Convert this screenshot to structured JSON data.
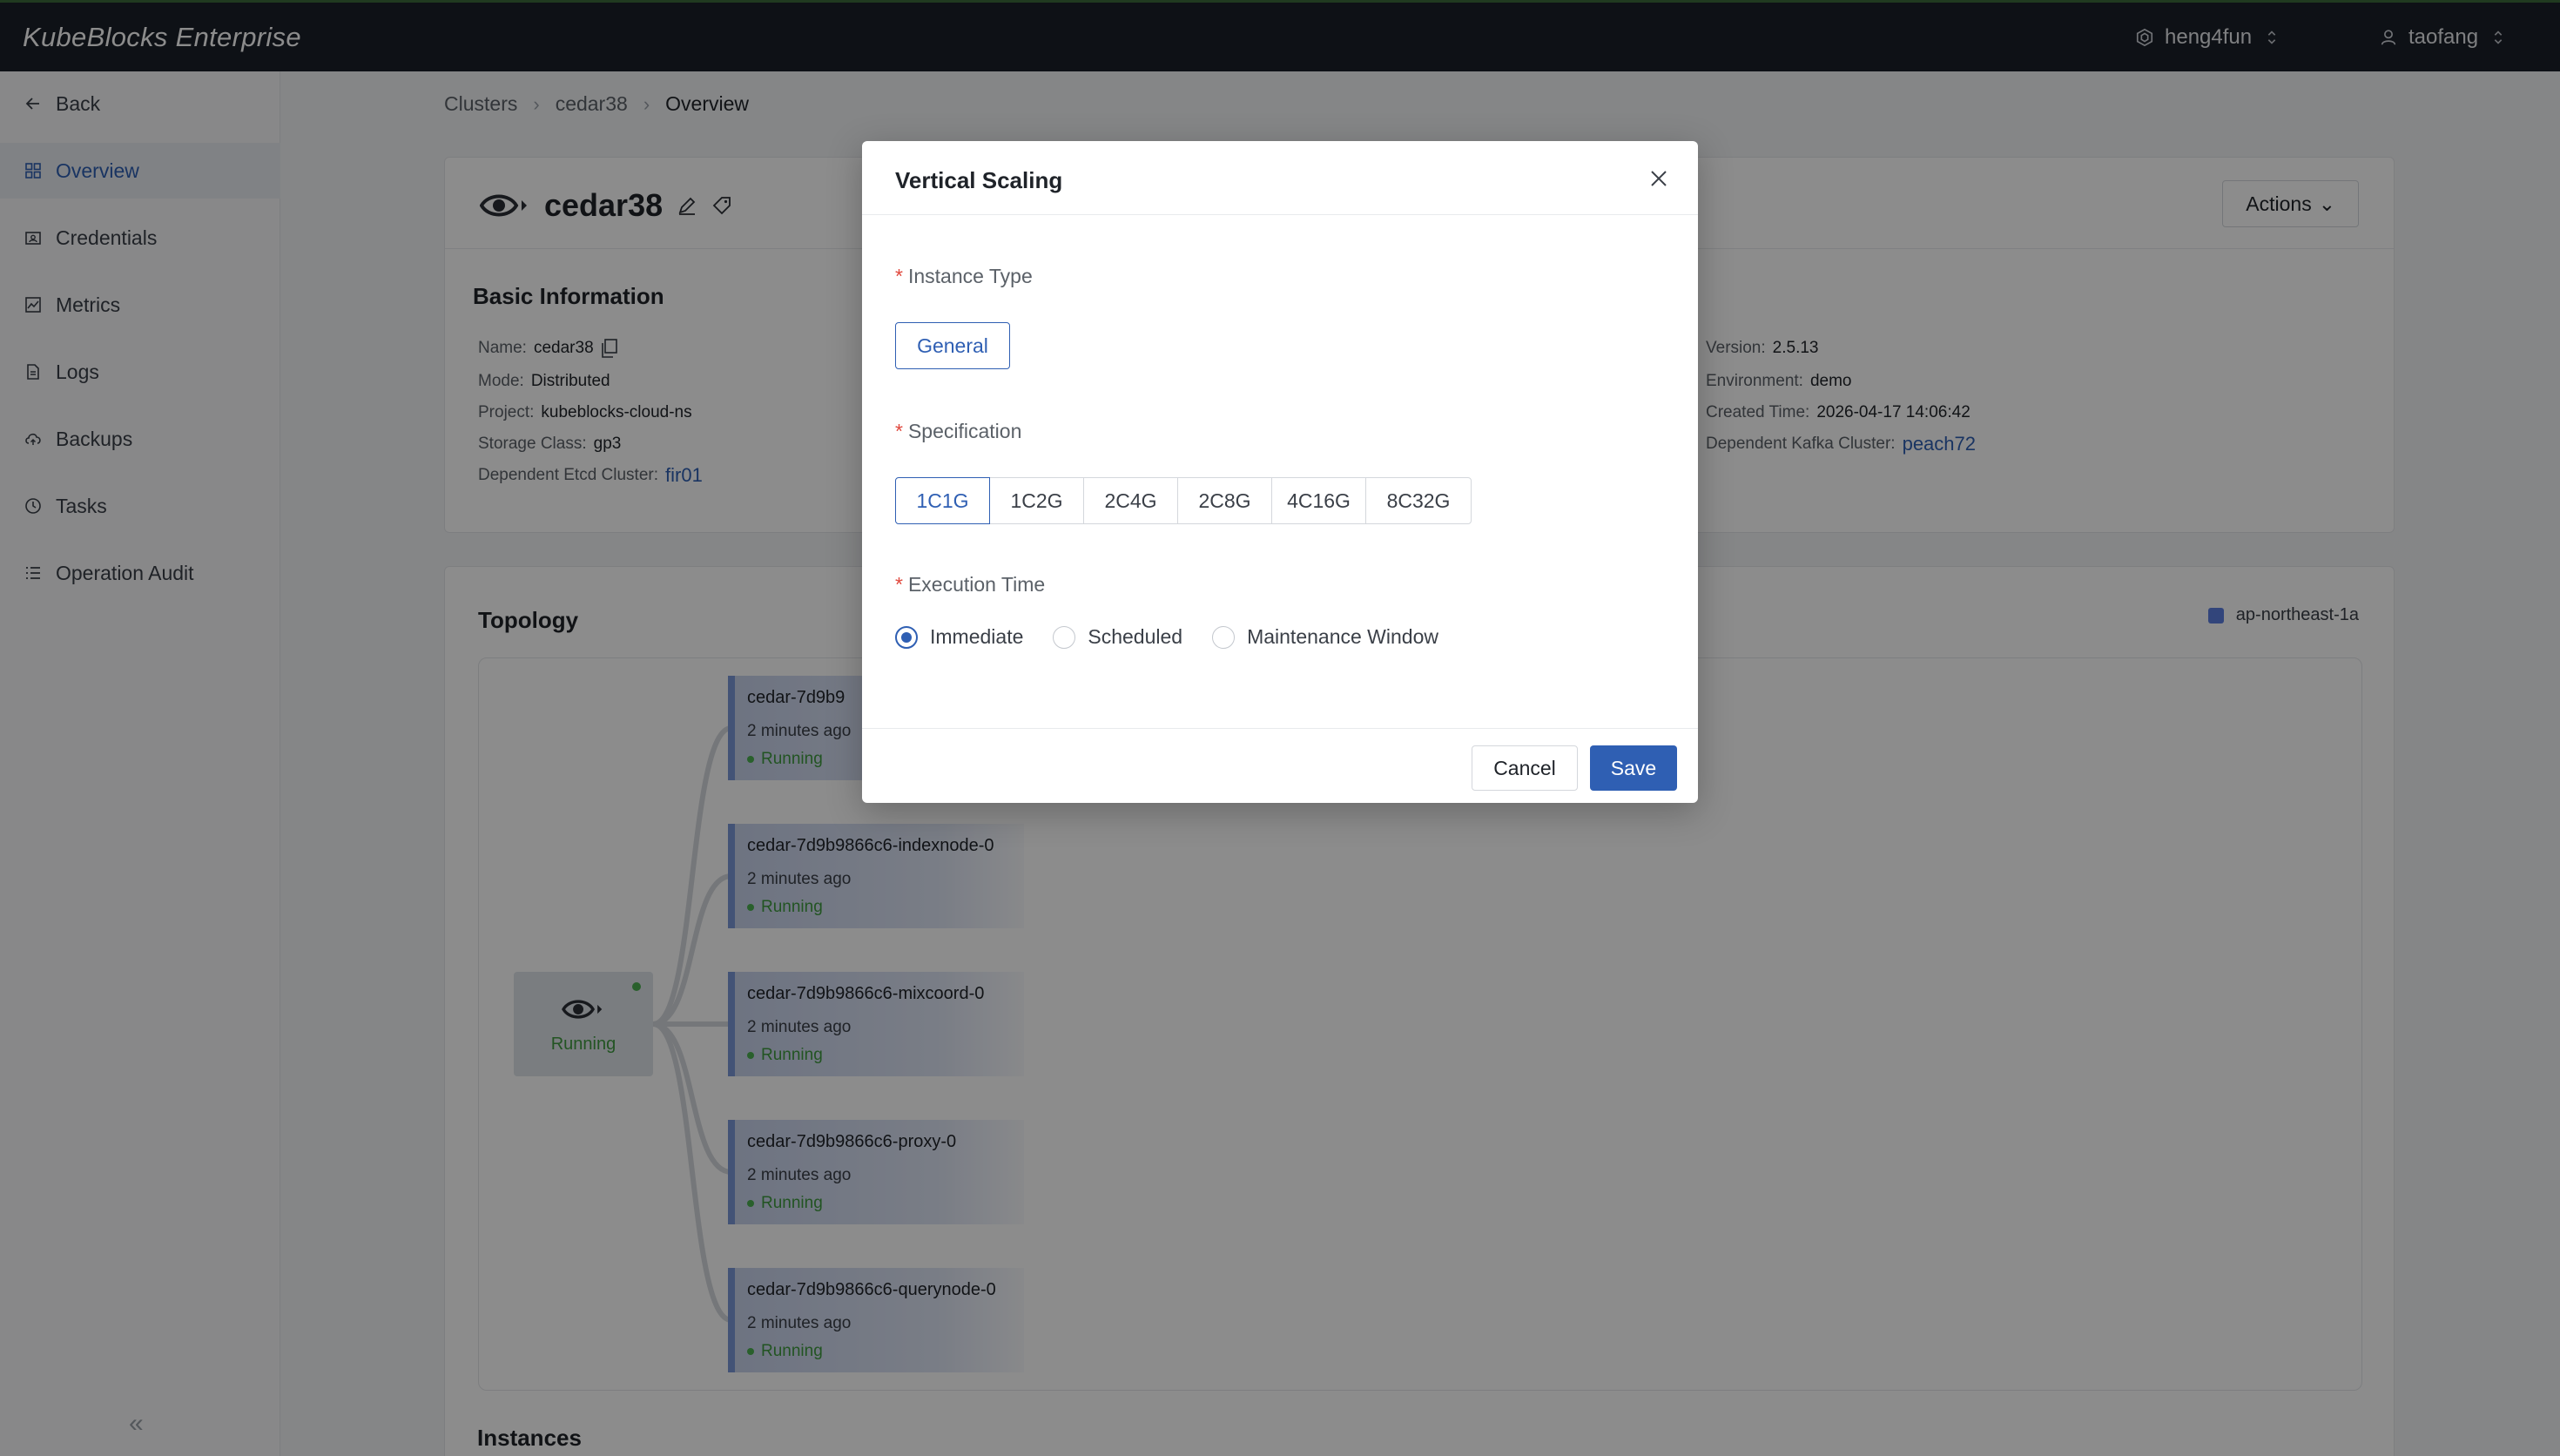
{
  "app": {
    "brand": "KubeBlocks Enterprise"
  },
  "topbar": {
    "org": "heng4fun",
    "user": "taofang"
  },
  "sidebar": {
    "items": [
      {
        "label": "Back",
        "icon": "arrow-left-icon"
      },
      {
        "label": "Overview",
        "icon": "grid-icon",
        "active": true
      },
      {
        "label": "Credentials",
        "icon": "credential-icon"
      },
      {
        "label": "Metrics",
        "icon": "chart-icon"
      },
      {
        "label": "Logs",
        "icon": "file-icon"
      },
      {
        "label": "Backups",
        "icon": "cloud-icon"
      },
      {
        "label": "Tasks",
        "icon": "clock-icon"
      },
      {
        "label": "Operation Audit",
        "icon": "list-icon"
      }
    ],
    "collapse": "«"
  },
  "breadcrumb": [
    "Clusters",
    "cedar38",
    "Overview"
  ],
  "cluster": {
    "name": "cedar38",
    "actions_label": "Actions",
    "basic_title": "Basic Information",
    "left_fields": [
      {
        "k": "Name:",
        "v": "cedar38"
      },
      {
        "k": "Mode:",
        "v": "Distributed"
      },
      {
        "k": "Project:",
        "v": "kubeblocks-cloud-ns"
      },
      {
        "k": "Storage Class:",
        "v": "gp3"
      },
      {
        "k": "Dependent Etcd Cluster:",
        "v": "fir01"
      }
    ],
    "right_fields": [
      {
        "k": "Version:",
        "v": "2.5.13"
      },
      {
        "k": "Environment:",
        "v": "demo"
      },
      {
        "k": "Created Time:",
        "v": "2026-04-17 14:06:42"
      },
      {
        "k": "Dependent Kafka Cluster:",
        "v": "peach72"
      }
    ]
  },
  "topology": {
    "title": "Topology",
    "zone": "ap-northeast-1a",
    "root_status": "Running",
    "nodes": [
      {
        "name": "cedar-7d9b9",
        "time": "2 minutes ago",
        "status": "Running"
      },
      {
        "name": "cedar-7d9b9866c6-indexnode-0",
        "time": "2 minutes ago",
        "status": "Running"
      },
      {
        "name": "cedar-7d9b9866c6-mixcoord-0",
        "time": "2 minutes ago",
        "status": "Running"
      },
      {
        "name": "cedar-7d9b9866c6-proxy-0",
        "time": "2 minutes ago",
        "status": "Running"
      },
      {
        "name": "cedar-7d9b9866c6-querynode-0",
        "time": "2 minutes ago",
        "status": "Running"
      }
    ]
  },
  "instances_title": "Instances",
  "modal": {
    "title": "Vertical Scaling",
    "instance_type_label": "Instance Type",
    "instance_type_value": "General",
    "spec_label": "Specification",
    "specs": [
      "1C1G",
      "1C2G",
      "2C4G",
      "2C8G",
      "4C16G",
      "8C32G"
    ],
    "spec_selected": "1C1G",
    "exec_label": "Execution Time",
    "exec_options": [
      "Immediate",
      "Scheduled",
      "Maintenance Window"
    ],
    "exec_selected": "Immediate",
    "cancel": "Cancel",
    "save": "Save"
  }
}
